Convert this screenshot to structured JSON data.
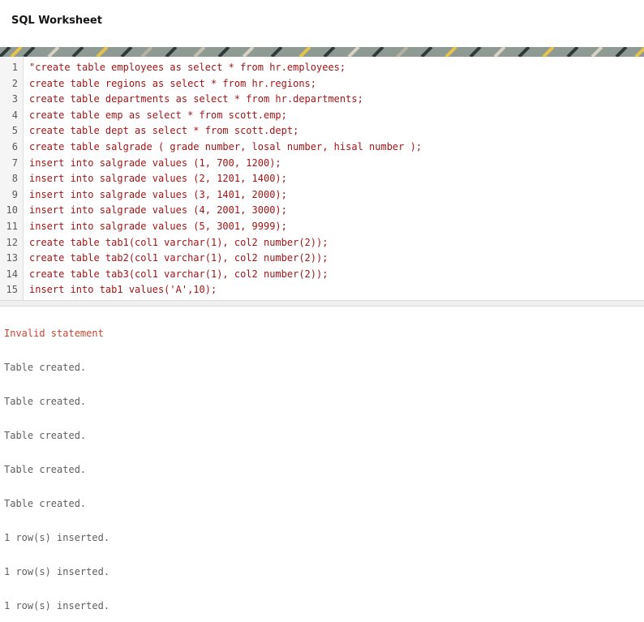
{
  "window": {
    "title": "SQL Worksheet"
  },
  "colors": {
    "code": "#a31515",
    "error": "#c74634",
    "output": "#5f5f5f"
  },
  "editor": {
    "lines": [
      {
        "num": "1",
        "code": "\"create table employees as select * from hr.employees;"
      },
      {
        "num": "2",
        "code": "create table regions as select * from hr.regions;"
      },
      {
        "num": "3",
        "code": "create table departments as select * from hr.departments;"
      },
      {
        "num": "4",
        "code": "create table emp as select * from scott.emp;"
      },
      {
        "num": "5",
        "code": "create table dept as select * from scott.dept;"
      },
      {
        "num": "6",
        "code": "create table salgrade ( grade number, losal number, hisal number );"
      },
      {
        "num": "7",
        "code": "insert into salgrade values (1, 700, 1200);"
      },
      {
        "num": "8",
        "code": "insert into salgrade values (2, 1201, 1400);"
      },
      {
        "num": "9",
        "code": "insert into salgrade values (3, 1401, 2000);"
      },
      {
        "num": "10",
        "code": "insert into salgrade values (4, 2001, 3000);"
      },
      {
        "num": "11",
        "code": "insert into salgrade values (5, 3001, 9999);"
      },
      {
        "num": "12",
        "code": "create table tab1(col1 varchar(1), col2 number(2));"
      },
      {
        "num": "13",
        "code": "create table tab2(col1 varchar(1), col2 number(2));"
      },
      {
        "num": "14",
        "code": "create table tab3(col1 varchar(1), col2 number(2));"
      },
      {
        "num": "15",
        "code": "insert into tab1 values('A',10);"
      }
    ]
  },
  "output": {
    "lines": [
      {
        "text": "Invalid statement",
        "type": "error"
      },
      {
        "text": "Table created.",
        "type": "info"
      },
      {
        "text": "Table created.",
        "type": "info"
      },
      {
        "text": "Table created.",
        "type": "info"
      },
      {
        "text": "Table created.",
        "type": "info"
      },
      {
        "text": "Table created.",
        "type": "info"
      },
      {
        "text": "1 row(s) inserted.",
        "type": "info"
      },
      {
        "text": "1 row(s) inserted.",
        "type": "info"
      },
      {
        "text": "1 row(s) inserted.",
        "type": "info"
      }
    ]
  }
}
